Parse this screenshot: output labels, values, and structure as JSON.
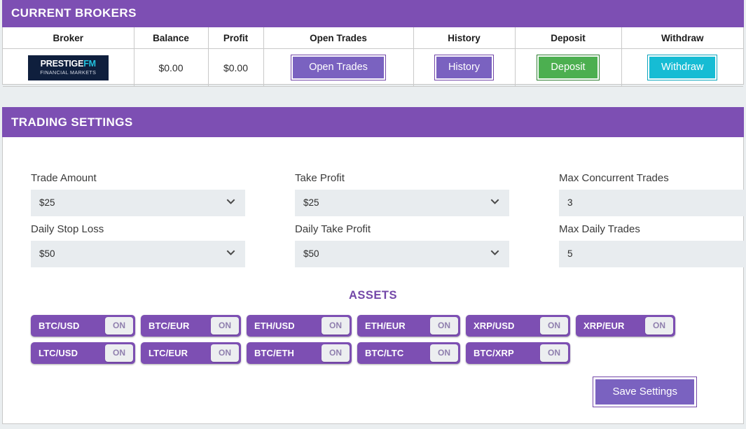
{
  "brokers_panel": {
    "title": "CURRENT BROKERS",
    "columns": [
      "Broker",
      "Balance",
      "Profit",
      "Open Trades",
      "History",
      "Deposit",
      "Withdraw"
    ],
    "row": {
      "logo_primary": "PRESTIGE",
      "logo_accent": "FM",
      "logo_sub": "FINANCIAL MARKETS",
      "balance": "$0.00",
      "profit": "$0.00",
      "open_trades_label": "Open Trades",
      "history_label": "History",
      "deposit_label": "Deposit",
      "withdraw_label": "Withdraw"
    }
  },
  "settings_panel": {
    "title": "TRADING SETTINGS",
    "fields": [
      {
        "label": "Trade Amount",
        "value": "$25"
      },
      {
        "label": "Take Profit",
        "value": "$25"
      },
      {
        "label": "Max Concurrent Trades",
        "value": "3"
      },
      {
        "label": "Daily Stop Loss",
        "value": "$50"
      },
      {
        "label": "Daily Take Profit",
        "value": "$50"
      },
      {
        "label": "Max Daily Trades",
        "value": "5"
      }
    ],
    "assets_title": "ASSETS",
    "assets": [
      {
        "name": "BTC/USD",
        "state": "ON"
      },
      {
        "name": "BTC/EUR",
        "state": "ON"
      },
      {
        "name": "ETH/USD",
        "state": "ON"
      },
      {
        "name": "ETH/EUR",
        "state": "ON"
      },
      {
        "name": "XRP/USD",
        "state": "ON"
      },
      {
        "name": "XRP/EUR",
        "state": "ON"
      },
      {
        "name": "LTC/USD",
        "state": "ON"
      },
      {
        "name": "LTC/EUR",
        "state": "ON"
      },
      {
        "name": "BTC/ETH",
        "state": "ON"
      },
      {
        "name": "BTC/LTC",
        "state": "ON"
      },
      {
        "name": "BTC/XRP",
        "state": "ON"
      }
    ],
    "save_label": "Save Settings"
  },
  "colors": {
    "brand_purple": "#7d4fb3",
    "button_purple": "#7a62c0",
    "deposit_green": "#4caf50",
    "withdraw_cyan": "#16bcd4",
    "page_background": "#eaeef0",
    "select_background": "#e8ecef"
  }
}
